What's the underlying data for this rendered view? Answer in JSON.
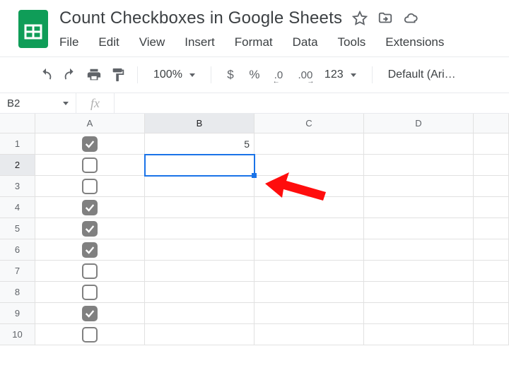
{
  "doc": {
    "title": "Count Checkboxes in Google Sheets"
  },
  "menus": [
    "File",
    "Edit",
    "View",
    "Insert",
    "Format",
    "Data",
    "Tools",
    "Extensions"
  ],
  "toolbar": {
    "zoom": "100%",
    "currency": "$",
    "percent": "%",
    "dec_dec": ".0",
    "dec_inc": ".00",
    "num_format": "123",
    "font": "Default (Ari…"
  },
  "namebox": {
    "value": "B2"
  },
  "fx": {
    "label": "fx",
    "value": ""
  },
  "columns": [
    "A",
    "B",
    "C",
    "D",
    ""
  ],
  "rows": [
    "1",
    "2",
    "3",
    "4",
    "5",
    "6",
    "7",
    "8",
    "9",
    "10"
  ],
  "selected": {
    "col": "B",
    "row": "2"
  },
  "cells": {
    "B1": {
      "type": "number",
      "value": "5"
    },
    "A1": {
      "type": "checkbox",
      "checked": true
    },
    "A2": {
      "type": "checkbox",
      "checked": false
    },
    "A3": {
      "type": "checkbox",
      "checked": false
    },
    "A4": {
      "type": "checkbox",
      "checked": true
    },
    "A5": {
      "type": "checkbox",
      "checked": true
    },
    "A6": {
      "type": "checkbox",
      "checked": true
    },
    "A7": {
      "type": "checkbox",
      "checked": false
    },
    "A8": {
      "type": "checkbox",
      "checked": false
    },
    "A9": {
      "type": "checkbox",
      "checked": true
    },
    "A10": {
      "type": "checkbox",
      "checked": false
    }
  }
}
